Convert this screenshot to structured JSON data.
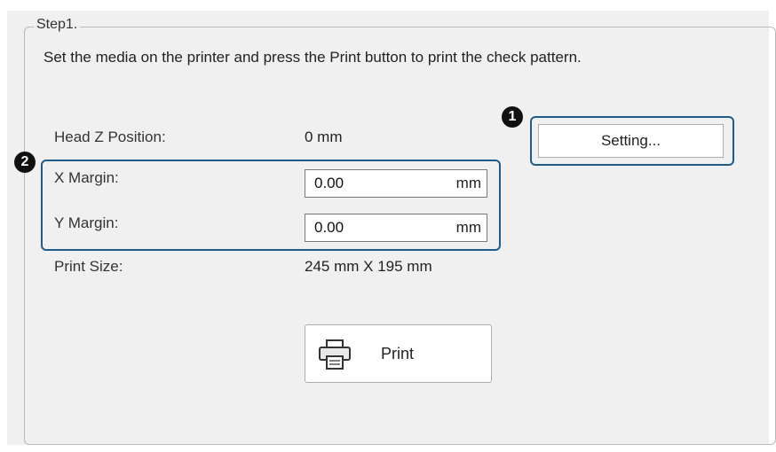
{
  "step": {
    "title": "Step1.",
    "instruction": "Set the media on the printer and press the Print button to print the check pattern."
  },
  "fields": {
    "head_z": {
      "label": "Head Z Position:",
      "value": "0 mm"
    },
    "x_margin": {
      "label": "X Margin:",
      "value": "0.00",
      "unit": "mm"
    },
    "y_margin": {
      "label": "Y Margin:",
      "value": "0.00",
      "unit": "mm"
    },
    "print_size": {
      "label": "Print Size:",
      "value": "245 mm X 195 mm"
    }
  },
  "buttons": {
    "setting": "Setting...",
    "print": "Print"
  },
  "callouts": [
    "1",
    "2"
  ],
  "icons": {
    "print": "printer-icon"
  },
  "colors": {
    "callout": "#1f5c8c",
    "panel": "#f0f0f0"
  }
}
